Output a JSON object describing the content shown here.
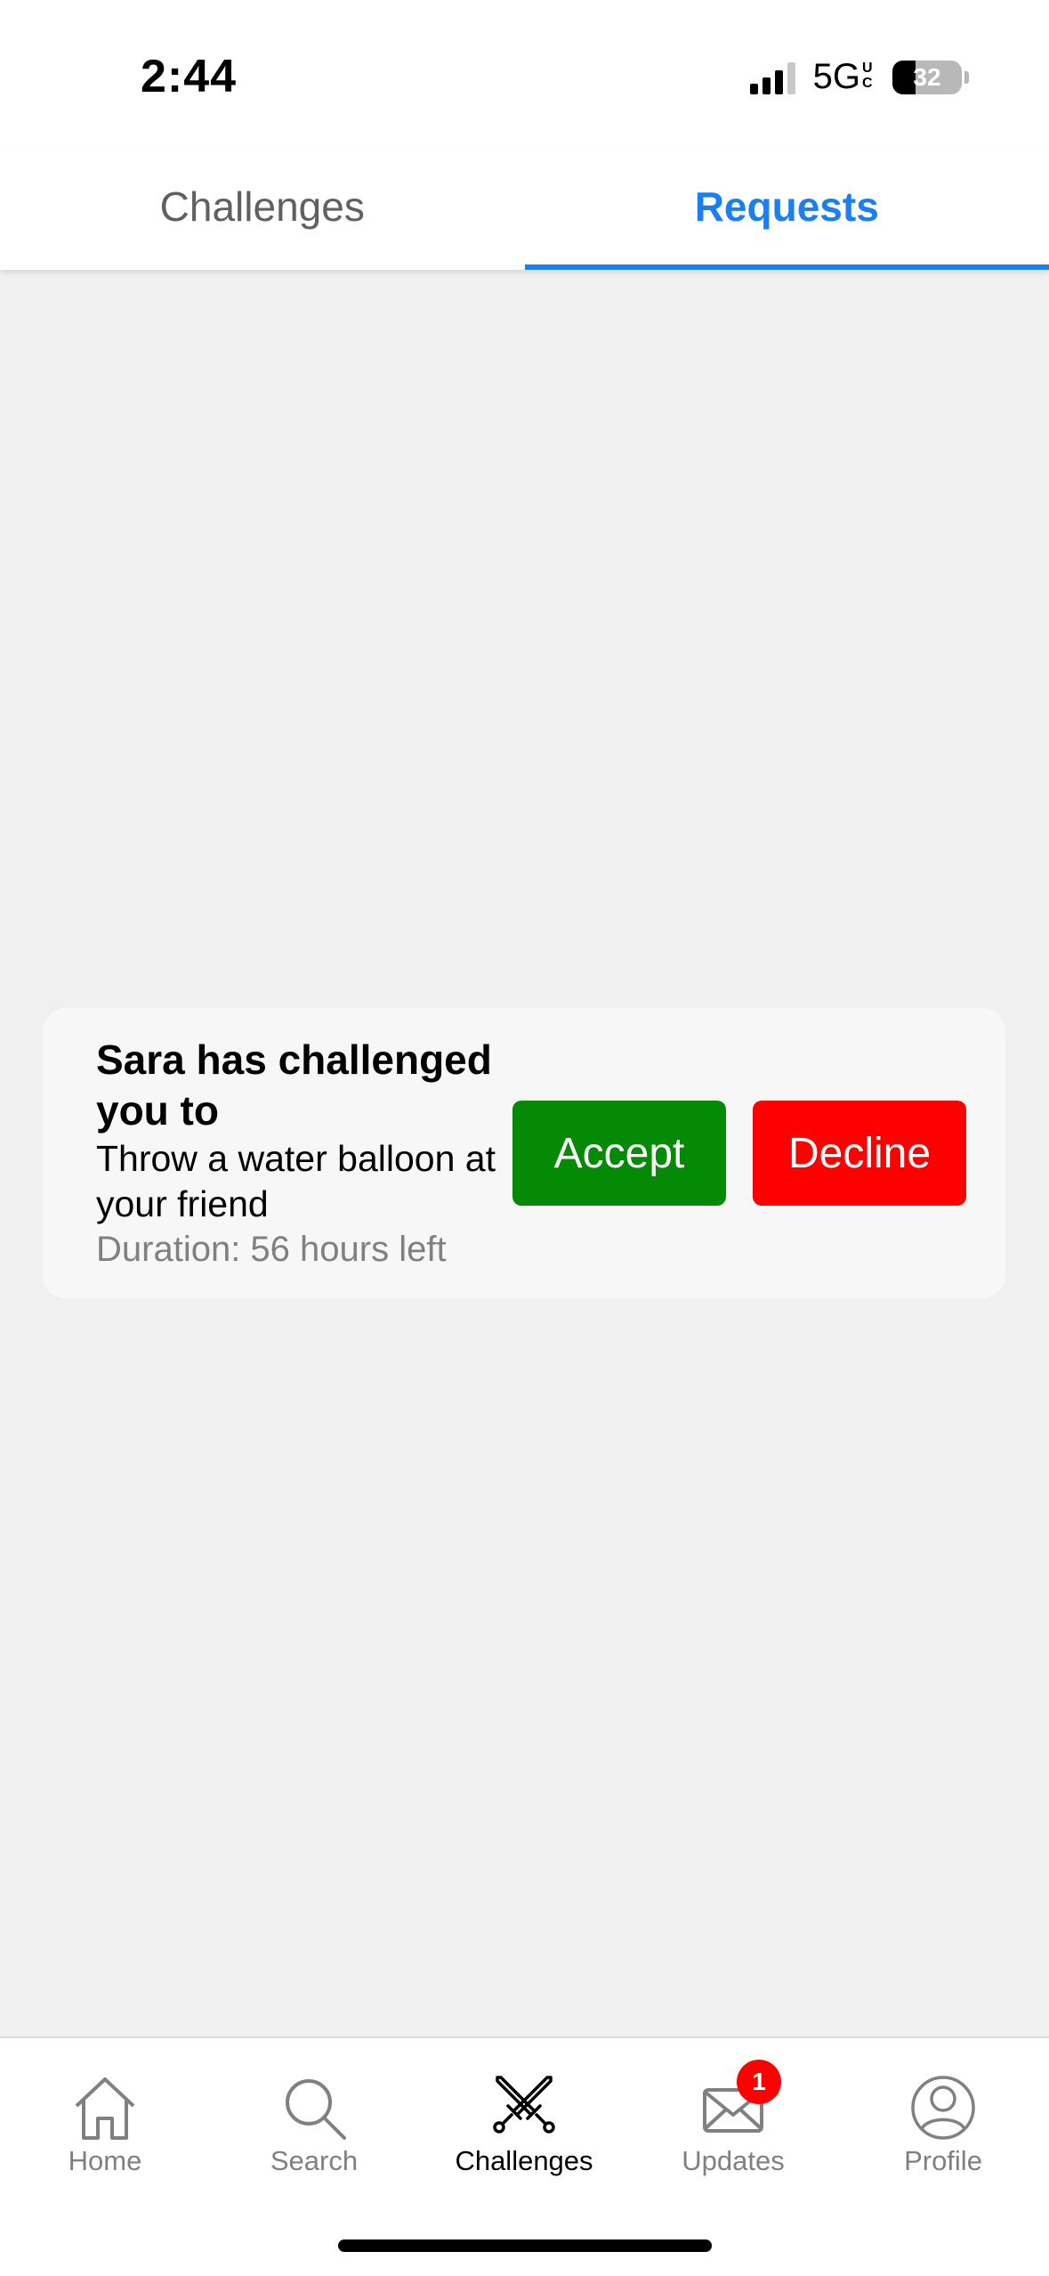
{
  "status_bar": {
    "time": "2:44",
    "network": "5G",
    "network_suffix": "UC",
    "battery": "32"
  },
  "tabs": [
    {
      "label": "Challenges",
      "active": false
    },
    {
      "label": "Requests",
      "active": true
    }
  ],
  "request": {
    "title": "Sara has challenged you to",
    "description": "Throw a water balloon at your friend",
    "duration": "Duration: 56 hours left",
    "accept_label": "Accept",
    "decline_label": "Decline"
  },
  "colors": {
    "accent": "#1a7ff0",
    "accept": "#058a05",
    "decline": "#ff0000",
    "badge": "#ff0000"
  },
  "bottom_nav": {
    "items": [
      {
        "label": "Home",
        "icon": "house-icon",
        "active": false
      },
      {
        "label": "Search",
        "icon": "magnifier-icon",
        "active": false
      },
      {
        "label": "Challenges",
        "icon": "crossed-swords-icon",
        "active": true
      },
      {
        "label": "Updates",
        "icon": "envelope-icon",
        "active": false,
        "badge": "1"
      },
      {
        "label": "Profile",
        "icon": "person-circle-icon",
        "active": false
      }
    ]
  }
}
